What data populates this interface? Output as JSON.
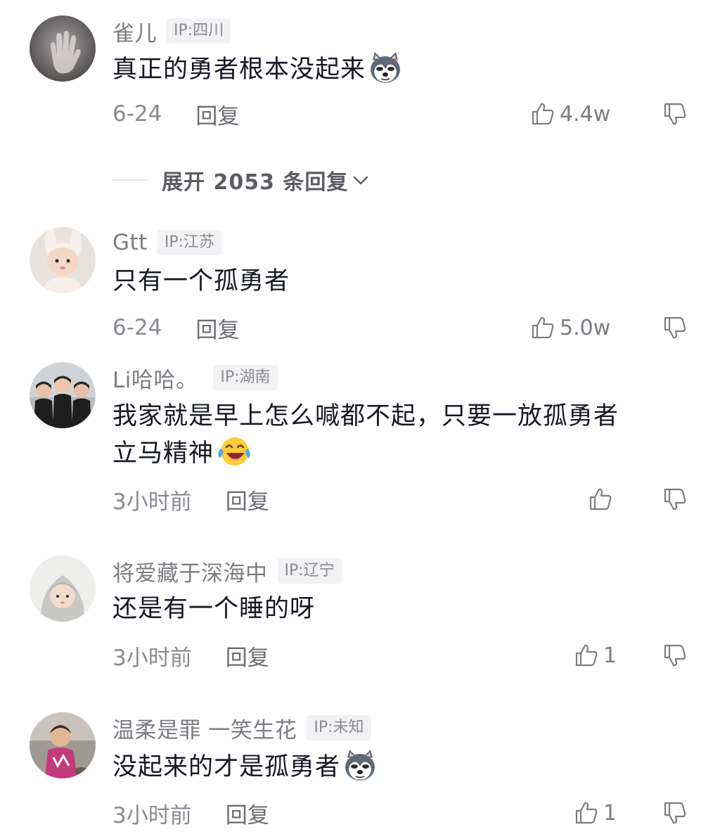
{
  "comments": [
    {
      "username": "雀儿",
      "ip": "IP:四川",
      "text": "真正的勇者根本没起来",
      "emoji": "husky-dog-emoji",
      "date": "6-24",
      "reply_label": "回复",
      "likes": "4.4w"
    },
    {
      "username": "Gtt",
      "ip": "IP:江苏",
      "text": "只有一个孤勇者",
      "date": "6-24",
      "reply_label": "回复",
      "likes": "5.0w"
    },
    {
      "username": "Li哈哈。",
      "ip": "IP:湖南",
      "text_line1": "我家就是早上怎么喊都不起，只要一放孤勇者",
      "text_line2": "立马精神",
      "emoji": "laughing-crying-emoji",
      "date": "3小时前",
      "reply_label": "回复",
      "likes": ""
    },
    {
      "username": "将爱藏于深海中",
      "ip": "IP:辽宁",
      "text": "还是有一个睡的呀",
      "date": "3小时前",
      "reply_label": "回复",
      "likes": "1"
    },
    {
      "username": "温柔是罪 一笑生花",
      "ip": "IP:未知",
      "text": "没起来的才是孤勇者",
      "emoji": "husky-dog-emoji",
      "date": "3小时前",
      "reply_label": "回复",
      "likes": "1"
    }
  ],
  "expand_replies": "展开 2053 条回复",
  "icons": {
    "like": "thumbs-up-icon",
    "dislike": "thumbs-down-icon",
    "expand": "chevron-down-icon"
  },
  "colors": {
    "text": "#161823",
    "muted": "#8a8b91",
    "badge_bg": "#f2f2f4"
  }
}
